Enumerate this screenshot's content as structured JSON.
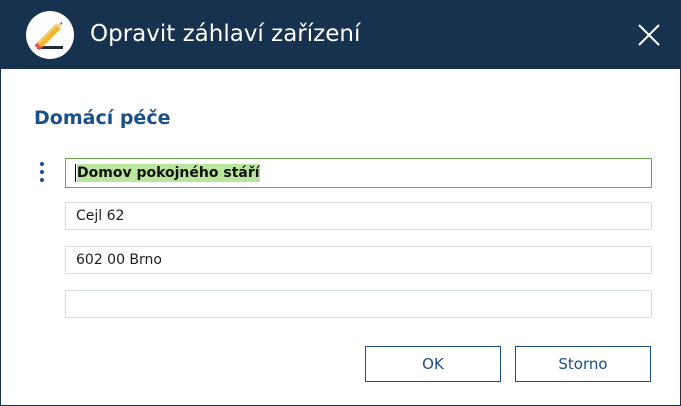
{
  "window": {
    "title": "Opravit záhlaví zařízení",
    "icon": "pencil-icon",
    "close_icon": "close-icon"
  },
  "section": {
    "heading": "Domácí péče",
    "menu_icon": "more-vertical-icon"
  },
  "fields": [
    {
      "value": "Domov pokojného stáří",
      "selected": true
    },
    {
      "value": "Cejl 62"
    },
    {
      "value": "602 00 Brno"
    },
    {
      "value": ""
    }
  ],
  "buttons": {
    "ok_label": "OK",
    "cancel_label": "Storno"
  },
  "colors": {
    "titlebar": "#16324f",
    "accent": "#1b4f8a",
    "selection": "#b9e59d",
    "active_border": "#6aa84f"
  }
}
